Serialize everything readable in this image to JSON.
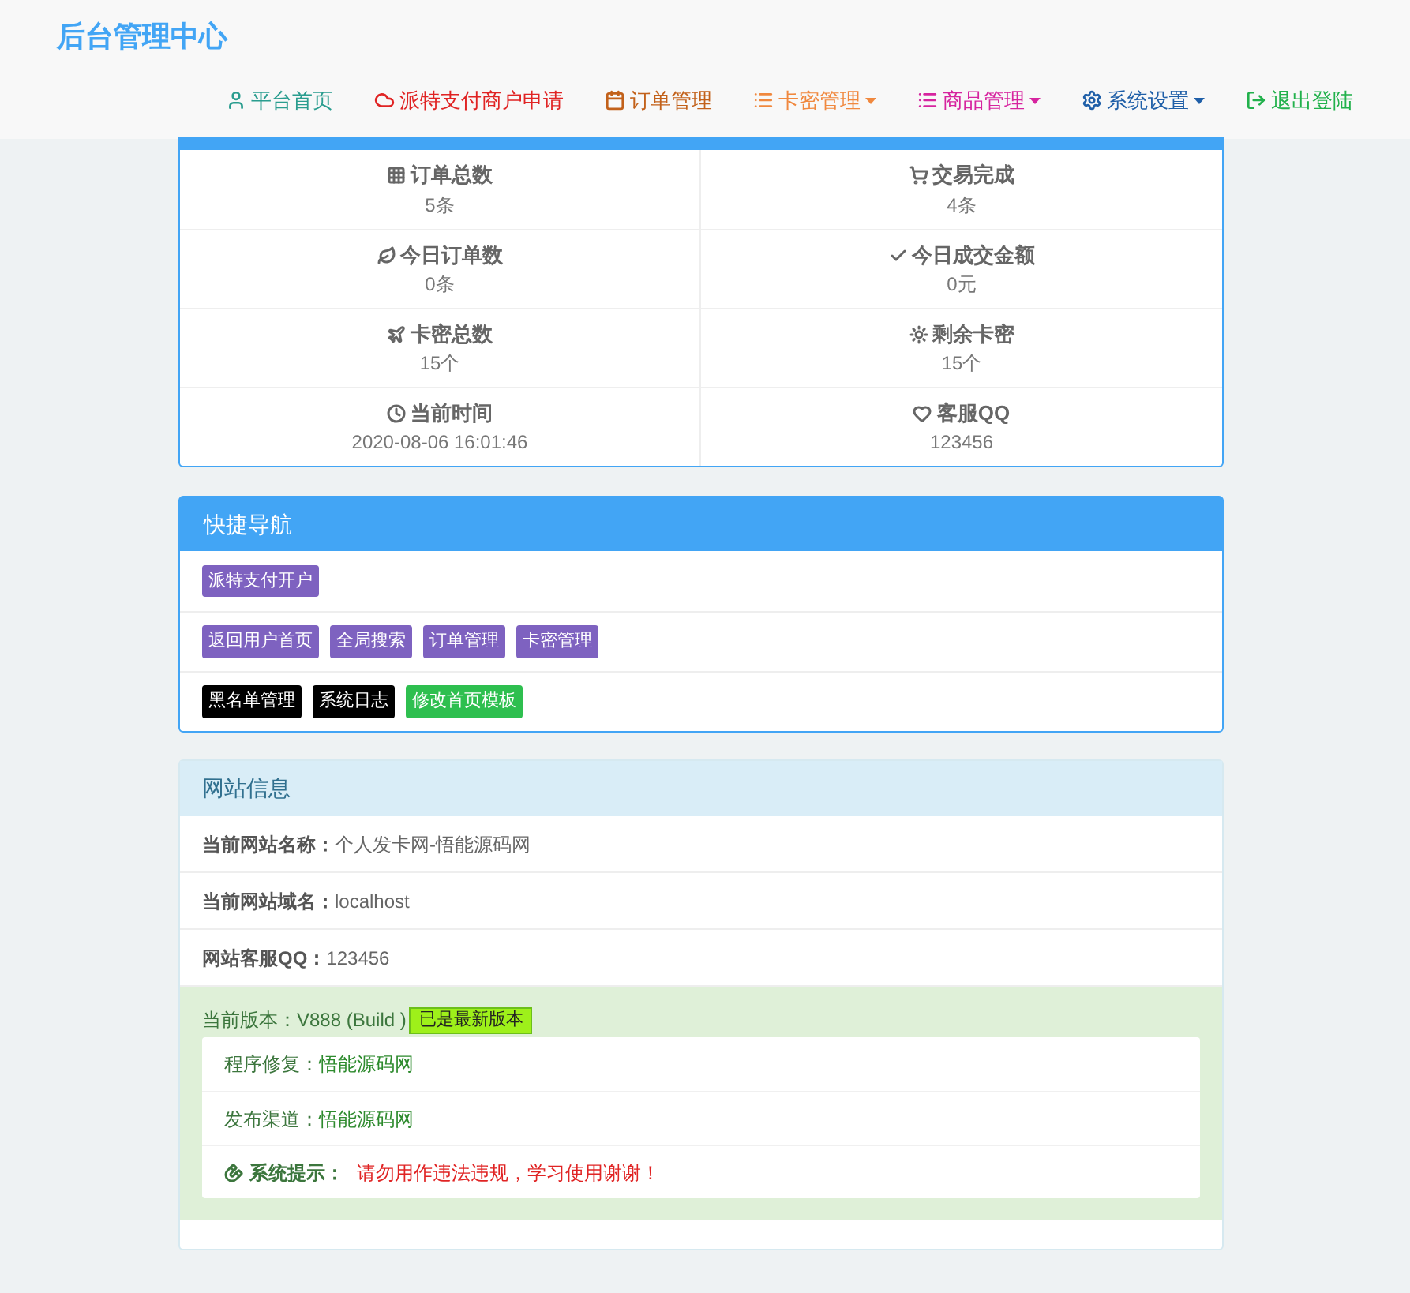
{
  "brand": "后台管理中心",
  "nav": [
    {
      "label": "平台首页",
      "color": "#2a9d8f",
      "dropdown": false
    },
    {
      "label": "派特支付商户申请",
      "color": "#e02424",
      "dropdown": false
    },
    {
      "label": "订单管理",
      "color": "#c2611a",
      "dropdown": false
    },
    {
      "label": "卡密管理",
      "color": "#f0883e",
      "dropdown": true
    },
    {
      "label": "商品管理",
      "color": "#d6249f",
      "dropdown": true
    },
    {
      "label": "系统设置",
      "color": "#1f5fa8",
      "dropdown": true
    },
    {
      "label": "退出登陆",
      "color": "#22b14c",
      "dropdown": false
    }
  ],
  "stats": [
    {
      "label": "订单总数",
      "value": "5条"
    },
    {
      "label": "交易完成",
      "value": "4条"
    },
    {
      "label": "今日订单数",
      "value": "0条"
    },
    {
      "label": "今日成交金额",
      "value": "0元"
    },
    {
      "label": "卡密总数",
      "value": "15个"
    },
    {
      "label": "剩余卡密",
      "value": "15个"
    },
    {
      "label": "当前时间",
      "value": "2020-08-06 16:01:46"
    },
    {
      "label": "客服QQ",
      "value": "123456"
    }
  ],
  "quick_nav": {
    "title": "快捷导航",
    "rows": [
      [
        {
          "label": "派特支付开户",
          "color": "#7e62c0"
        }
      ],
      [
        {
          "label": "返回用户首页",
          "color": "#7e62c0"
        },
        {
          "label": "全局搜索",
          "color": "#7e62c0"
        },
        {
          "label": "订单管理",
          "color": "#7e62c0"
        },
        {
          "label": "卡密管理",
          "color": "#7e62c0"
        }
      ],
      [
        {
          "label": "黑名单管理",
          "color": "#000000"
        },
        {
          "label": "系统日志",
          "color": "#000000"
        },
        {
          "label": "修改首页模板",
          "color": "#2ebf4f"
        }
      ]
    ]
  },
  "site_info": {
    "title": "网站信息",
    "rows": [
      {
        "label": "当前网站名称：",
        "value": "个人发卡网-悟能源码网"
      },
      {
        "label": "当前网站域名：",
        "value": "localhost"
      },
      {
        "label": "网站客服QQ：",
        "value": "123456"
      }
    ],
    "version": {
      "text": "当前版本：V888 (Build )",
      "badge": "已是最新版本",
      "items": [
        {
          "kind": "plain",
          "label": "程序修复：",
          "value": "悟能源码网"
        },
        {
          "kind": "plain",
          "label": "发布渠道：",
          "value": "悟能源码网"
        },
        {
          "kind": "notice",
          "label": "系统提示：",
          "value": "请勿用作违法违规，学习使用谢谢！"
        }
      ]
    }
  }
}
